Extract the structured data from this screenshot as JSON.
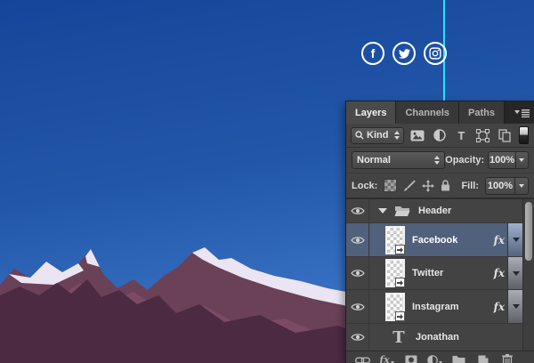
{
  "canvas": {
    "guide_color": "#35dcff",
    "facebook_glyph": "f",
    "social": [
      {
        "name": "facebook"
      },
      {
        "name": "twitter"
      },
      {
        "name": "instagram"
      }
    ]
  },
  "panel": {
    "tabs": [
      {
        "label": "Layers"
      },
      {
        "label": "Channels"
      },
      {
        "label": "Paths"
      }
    ],
    "filter": {
      "kind": "Kind"
    },
    "blend": {
      "mode": "Normal",
      "opacity_label": "Opacity:",
      "opacity_value": "100%"
    },
    "lock": {
      "label": "Lock:",
      "fill_label": "Fill:",
      "fill_value": "100%"
    },
    "fx_label": "fx",
    "text_layer_glyph": "T",
    "layers": [
      {
        "name": "Header",
        "type": "group"
      },
      {
        "name": "Facebook",
        "type": "smart-object",
        "selected": true
      },
      {
        "name": "Twitter",
        "type": "smart-object"
      },
      {
        "name": "Instagram",
        "type": "smart-object"
      },
      {
        "name": "Jonathan",
        "type": "text"
      }
    ]
  }
}
